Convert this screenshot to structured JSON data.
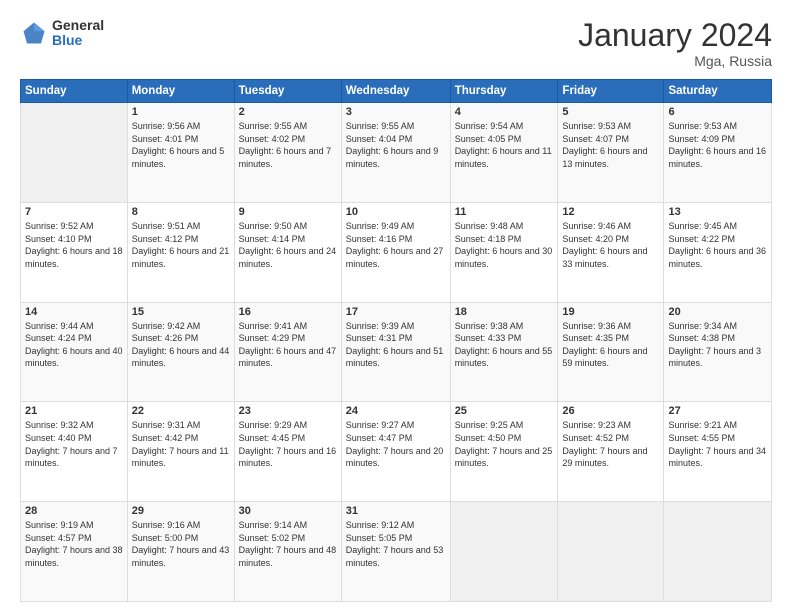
{
  "header": {
    "logo_general": "General",
    "logo_blue": "Blue",
    "month_title": "January 2024",
    "location": "Mga, Russia"
  },
  "days_of_week": [
    "Sunday",
    "Monday",
    "Tuesday",
    "Wednesday",
    "Thursday",
    "Friday",
    "Saturday"
  ],
  "weeks": [
    [
      {
        "date": "",
        "sunrise": "",
        "sunset": "",
        "daylight": ""
      },
      {
        "date": "1",
        "sunrise": "Sunrise: 9:56 AM",
        "sunset": "Sunset: 4:01 PM",
        "daylight": "Daylight: 6 hours and 5 minutes."
      },
      {
        "date": "2",
        "sunrise": "Sunrise: 9:55 AM",
        "sunset": "Sunset: 4:02 PM",
        "daylight": "Daylight: 6 hours and 7 minutes."
      },
      {
        "date": "3",
        "sunrise": "Sunrise: 9:55 AM",
        "sunset": "Sunset: 4:04 PM",
        "daylight": "Daylight: 6 hours and 9 minutes."
      },
      {
        "date": "4",
        "sunrise": "Sunrise: 9:54 AM",
        "sunset": "Sunset: 4:05 PM",
        "daylight": "Daylight: 6 hours and 11 minutes."
      },
      {
        "date": "5",
        "sunrise": "Sunrise: 9:53 AM",
        "sunset": "Sunset: 4:07 PM",
        "daylight": "Daylight: 6 hours and 13 minutes."
      },
      {
        "date": "6",
        "sunrise": "Sunrise: 9:53 AM",
        "sunset": "Sunset: 4:09 PM",
        "daylight": "Daylight: 6 hours and 16 minutes."
      }
    ],
    [
      {
        "date": "7",
        "sunrise": "Sunrise: 9:52 AM",
        "sunset": "Sunset: 4:10 PM",
        "daylight": "Daylight: 6 hours and 18 minutes."
      },
      {
        "date": "8",
        "sunrise": "Sunrise: 9:51 AM",
        "sunset": "Sunset: 4:12 PM",
        "daylight": "Daylight: 6 hours and 21 minutes."
      },
      {
        "date": "9",
        "sunrise": "Sunrise: 9:50 AM",
        "sunset": "Sunset: 4:14 PM",
        "daylight": "Daylight: 6 hours and 24 minutes."
      },
      {
        "date": "10",
        "sunrise": "Sunrise: 9:49 AM",
        "sunset": "Sunset: 4:16 PM",
        "daylight": "Daylight: 6 hours and 27 minutes."
      },
      {
        "date": "11",
        "sunrise": "Sunrise: 9:48 AM",
        "sunset": "Sunset: 4:18 PM",
        "daylight": "Daylight: 6 hours and 30 minutes."
      },
      {
        "date": "12",
        "sunrise": "Sunrise: 9:46 AM",
        "sunset": "Sunset: 4:20 PM",
        "daylight": "Daylight: 6 hours and 33 minutes."
      },
      {
        "date": "13",
        "sunrise": "Sunrise: 9:45 AM",
        "sunset": "Sunset: 4:22 PM",
        "daylight": "Daylight: 6 hours and 36 minutes."
      }
    ],
    [
      {
        "date": "14",
        "sunrise": "Sunrise: 9:44 AM",
        "sunset": "Sunset: 4:24 PM",
        "daylight": "Daylight: 6 hours and 40 minutes."
      },
      {
        "date": "15",
        "sunrise": "Sunrise: 9:42 AM",
        "sunset": "Sunset: 4:26 PM",
        "daylight": "Daylight: 6 hours and 44 minutes."
      },
      {
        "date": "16",
        "sunrise": "Sunrise: 9:41 AM",
        "sunset": "Sunset: 4:29 PM",
        "daylight": "Daylight: 6 hours and 47 minutes."
      },
      {
        "date": "17",
        "sunrise": "Sunrise: 9:39 AM",
        "sunset": "Sunset: 4:31 PM",
        "daylight": "Daylight: 6 hours and 51 minutes."
      },
      {
        "date": "18",
        "sunrise": "Sunrise: 9:38 AM",
        "sunset": "Sunset: 4:33 PM",
        "daylight": "Daylight: 6 hours and 55 minutes."
      },
      {
        "date": "19",
        "sunrise": "Sunrise: 9:36 AM",
        "sunset": "Sunset: 4:35 PM",
        "daylight": "Daylight: 6 hours and 59 minutes."
      },
      {
        "date": "20",
        "sunrise": "Sunrise: 9:34 AM",
        "sunset": "Sunset: 4:38 PM",
        "daylight": "Daylight: 7 hours and 3 minutes."
      }
    ],
    [
      {
        "date": "21",
        "sunrise": "Sunrise: 9:32 AM",
        "sunset": "Sunset: 4:40 PM",
        "daylight": "Daylight: 7 hours and 7 minutes."
      },
      {
        "date": "22",
        "sunrise": "Sunrise: 9:31 AM",
        "sunset": "Sunset: 4:42 PM",
        "daylight": "Daylight: 7 hours and 11 minutes."
      },
      {
        "date": "23",
        "sunrise": "Sunrise: 9:29 AM",
        "sunset": "Sunset: 4:45 PM",
        "daylight": "Daylight: 7 hours and 16 minutes."
      },
      {
        "date": "24",
        "sunrise": "Sunrise: 9:27 AM",
        "sunset": "Sunset: 4:47 PM",
        "daylight": "Daylight: 7 hours and 20 minutes."
      },
      {
        "date": "25",
        "sunrise": "Sunrise: 9:25 AM",
        "sunset": "Sunset: 4:50 PM",
        "daylight": "Daylight: 7 hours and 25 minutes."
      },
      {
        "date": "26",
        "sunrise": "Sunrise: 9:23 AM",
        "sunset": "Sunset: 4:52 PM",
        "daylight": "Daylight: 7 hours and 29 minutes."
      },
      {
        "date": "27",
        "sunrise": "Sunrise: 9:21 AM",
        "sunset": "Sunset: 4:55 PM",
        "daylight": "Daylight: 7 hours and 34 minutes."
      }
    ],
    [
      {
        "date": "28",
        "sunrise": "Sunrise: 9:19 AM",
        "sunset": "Sunset: 4:57 PM",
        "daylight": "Daylight: 7 hours and 38 minutes."
      },
      {
        "date": "29",
        "sunrise": "Sunrise: 9:16 AM",
        "sunset": "Sunset: 5:00 PM",
        "daylight": "Daylight: 7 hours and 43 minutes."
      },
      {
        "date": "30",
        "sunrise": "Sunrise: 9:14 AM",
        "sunset": "Sunset: 5:02 PM",
        "daylight": "Daylight: 7 hours and 48 minutes."
      },
      {
        "date": "31",
        "sunrise": "Sunrise: 9:12 AM",
        "sunset": "Sunset: 5:05 PM",
        "daylight": "Daylight: 7 hours and 53 minutes."
      },
      {
        "date": "",
        "sunrise": "",
        "sunset": "",
        "daylight": ""
      },
      {
        "date": "",
        "sunrise": "",
        "sunset": "",
        "daylight": ""
      },
      {
        "date": "",
        "sunrise": "",
        "sunset": "",
        "daylight": ""
      }
    ]
  ]
}
